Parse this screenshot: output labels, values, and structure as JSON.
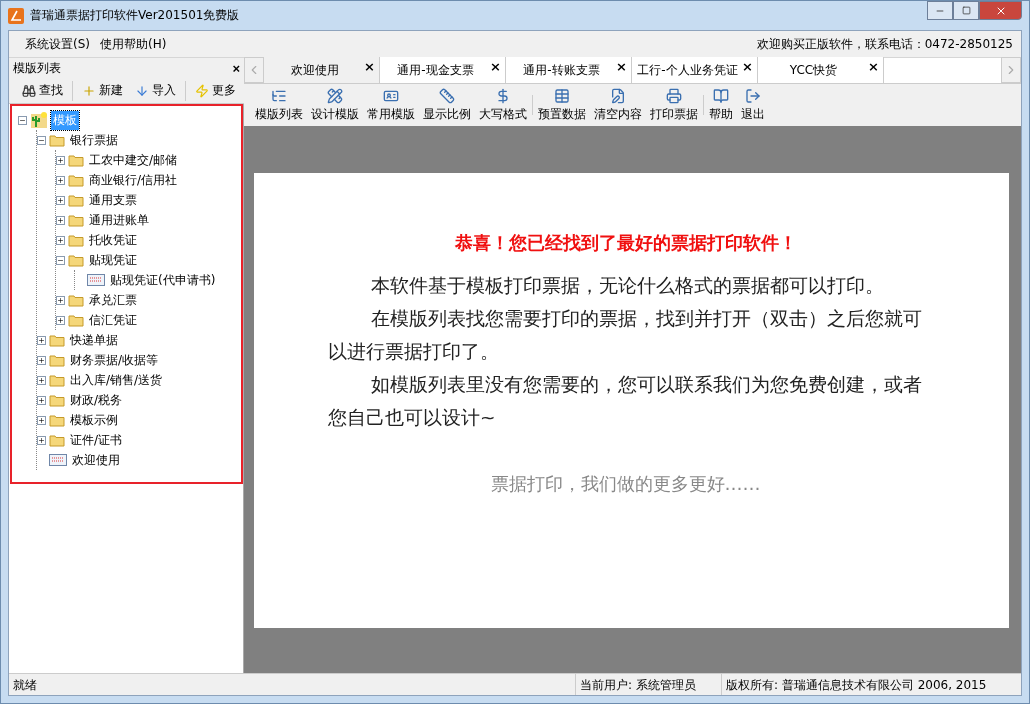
{
  "window": {
    "title": "普瑞通票据打印软件Ver201501免费版"
  },
  "menu": [
    "系统设置(S)",
    "使用帮助(H)"
  ],
  "promo": "欢迎购买正版软件，联系电话：0472-2850125",
  "left_panel": {
    "title": "模版列表",
    "close": "×",
    "toolbar": [
      "查找",
      "新建",
      "导入",
      "更多"
    ],
    "tree": [
      {
        "label": "模板",
        "kind": "root",
        "selected": true,
        "expanded": true,
        "children": [
          {
            "label": "银行票据",
            "kind": "folder",
            "selected": false,
            "expanded": true,
            "children": [
              {
                "label": "工农中建交/邮储",
                "kind": "folder",
                "selected": false,
                "expanded": false
              },
              {
                "label": "商业银行/信用社",
                "kind": "folder",
                "selected": false,
                "expanded": false
              },
              {
                "label": "通用支票",
                "kind": "folder",
                "selected": false,
                "expanded": false
              },
              {
                "label": "通用进账单",
                "kind": "folder",
                "selected": false,
                "expanded": false
              },
              {
                "label": "托收凭证",
                "kind": "folder",
                "selected": false,
                "expanded": false
              },
              {
                "label": "贴现凭证",
                "kind": "folder",
                "selected": false,
                "expanded": true,
                "children": [
                  {
                    "label": "贴现凭证(代申请书)",
                    "kind": "document",
                    "selected": false
                  }
                ]
              },
              {
                "label": "承兑汇票",
                "kind": "folder",
                "selected": false,
                "expanded": false
              },
              {
                "label": "信汇凭证",
                "kind": "folder",
                "selected": false,
                "expanded": false
              }
            ]
          },
          {
            "label": "快递单据",
            "kind": "folder",
            "selected": false,
            "expanded": false
          },
          {
            "label": "财务票据/收据等",
            "kind": "folder",
            "selected": false,
            "expanded": false
          },
          {
            "label": "出入库/销售/送货",
            "kind": "folder",
            "selected": false,
            "expanded": false
          },
          {
            "label": "财政/税务",
            "kind": "folder",
            "selected": false,
            "expanded": false
          },
          {
            "label": "模板示例",
            "kind": "folder",
            "selected": false,
            "expanded": false
          },
          {
            "label": "证件/证书",
            "kind": "folder",
            "selected": false,
            "expanded": false
          },
          {
            "label": "欢迎使用",
            "kind": "document",
            "selected": false
          }
        ]
      }
    ]
  },
  "tabs": [
    {
      "label": "欢迎使用",
      "selected": true
    },
    {
      "label": "通用-现金支票",
      "selected": false
    },
    {
      "label": "通用-转账支票",
      "selected": false
    },
    {
      "label": "工行-个人业务凭证",
      "selected": false
    },
    {
      "label": "YCC快货",
      "selected": false
    }
  ],
  "tab_close": "×",
  "toolbar": [
    [
      "模版列表",
      "设计模版",
      "常用模版",
      "显示比例",
      "大写格式"
    ],
    [
      "预置数据",
      "清空内容",
      "打印票据"
    ],
    [
      "帮助",
      "退出"
    ]
  ],
  "welcome": {
    "heading": "恭喜！您已经找到了最好的票据打印软件！",
    "paragraphs": [
      "本软件基于模板打印票据，无论什么格式的票据都可以打印。",
      "在模版列表找您需要打印的票据，找到并打开（双击）之后您就可以进行票据打印了。",
      "如模版列表里没有您需要的，您可以联系我们为您免费创建，或者您自己也可以设计~"
    ],
    "footer": "票据打印，我们做的更多更好……"
  },
  "status_bar": [
    "就绪",
    "当前用户: 系统管理员",
    "版权所有: 普瑞通信息技术有限公司 2006, 2015"
  ]
}
